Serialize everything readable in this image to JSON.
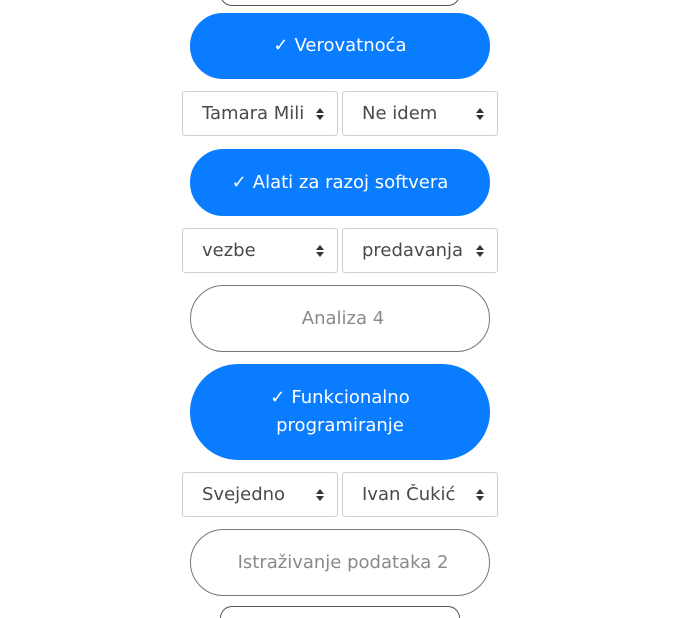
{
  "courses": [
    {
      "check": "✓",
      "title": "Verovatnoća",
      "selected": true
    },
    {
      "check": "✓",
      "title": "Alati za razoj softvera",
      "selected": true
    },
    {
      "check": "",
      "title": "Analiza 4",
      "selected": false
    },
    {
      "check": "✓",
      "title": "Funkcionalno programiranje",
      "selected": true
    },
    {
      "check": "",
      "title": "Istraživanje podataka 2",
      "selected": false
    }
  ],
  "selects": [
    {
      "left": "Tamara Mili",
      "right": "Ne idem"
    },
    {
      "left": "vezbe",
      "right": "predavanja"
    },
    {
      "left": "Svejedno",
      "right": "Ivan Čukić"
    }
  ],
  "icons": {
    "select_arrows": "sort-arrows-icon",
    "check": "checkmark"
  },
  "colors": {
    "accent": "#0a7cff",
    "unselected_text": "#8a8a8a",
    "border": "#777777"
  }
}
